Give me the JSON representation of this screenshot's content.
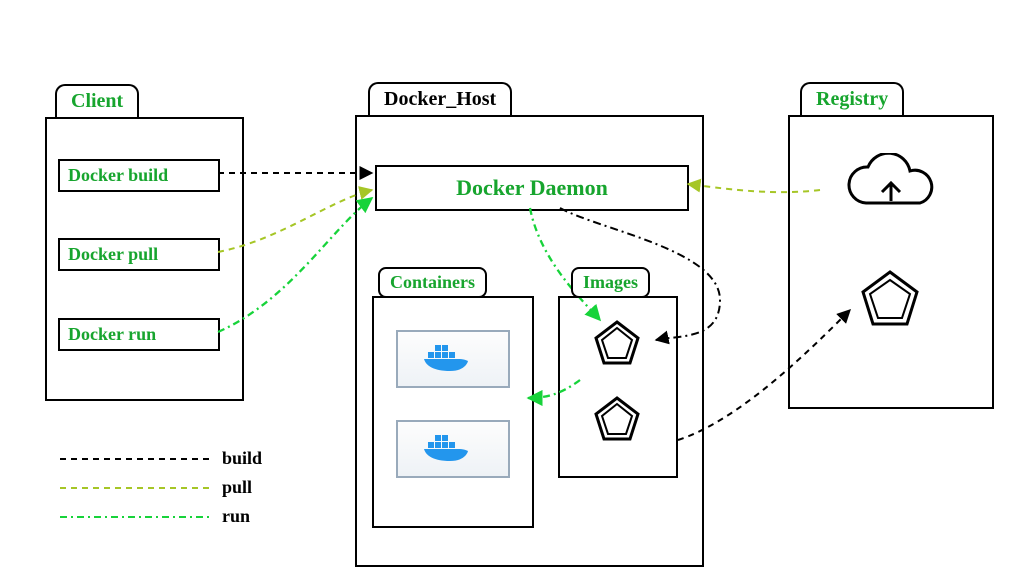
{
  "client": {
    "title": "Client",
    "commands": [
      "Docker build",
      "Docker pull",
      "Docker run"
    ]
  },
  "host": {
    "title": "Docker_Host",
    "daemon": "Docker Daemon",
    "containers_label": "Containers",
    "images_label": "Images"
  },
  "registry": {
    "title": "Registry"
  },
  "legend": {
    "build": "build",
    "pull": "pull",
    "run": "run"
  },
  "colors": {
    "build": "#000000",
    "pull": "#a6c626",
    "run": "#17d33a"
  }
}
